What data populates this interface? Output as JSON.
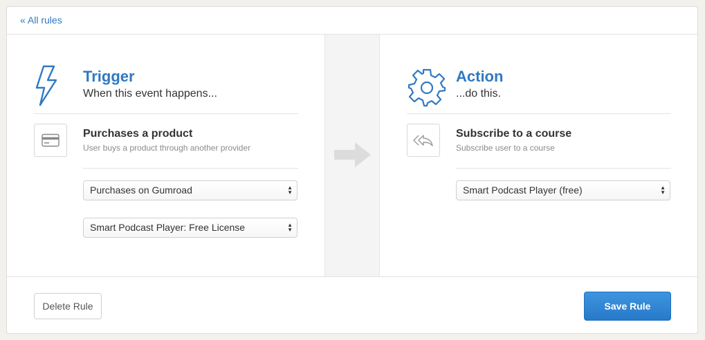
{
  "nav": {
    "back_label": "« All rules"
  },
  "trigger": {
    "title": "Trigger",
    "subtitle": "When this event happens...",
    "icon": "lightning-icon",
    "item": {
      "icon": "credit-card-icon",
      "title": "Purchases a product",
      "description": "User buys a product through another provider"
    },
    "selects": [
      {
        "value": "Purchases on Gumroad"
      },
      {
        "value": "Smart Podcast Player: Free License"
      }
    ]
  },
  "connector": {
    "icon": "arrow-right-icon"
  },
  "action": {
    "title": "Action",
    "subtitle": "...do this.",
    "icon": "gear-icon",
    "item": {
      "icon": "reply-all-icon",
      "title": "Subscribe to a course",
      "description": "Subscribe user to a course"
    },
    "selects": [
      {
        "value": "Smart Podcast Player (free)"
      }
    ]
  },
  "footer": {
    "delete_label": "Delete Rule",
    "save_label": "Save Rule"
  },
  "colors": {
    "accent": "#2f79c2",
    "save_button": "#2a7fd0",
    "background": "#f3f1ec"
  }
}
